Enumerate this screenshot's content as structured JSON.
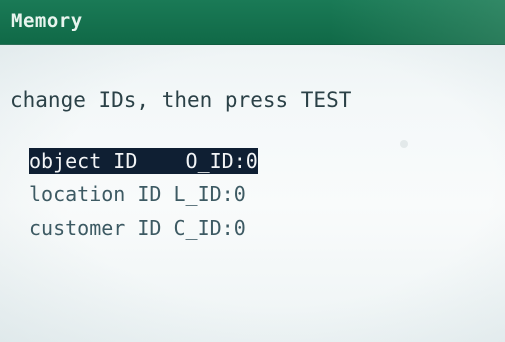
{
  "window": {
    "title": "Memory"
  },
  "instruction": "change IDs, then press TEST",
  "fields": [
    {
      "label": "object ID",
      "value": "O_ID:0",
      "selected": true
    },
    {
      "label": "location ID",
      "value": "L_ID:0",
      "selected": false
    },
    {
      "label": "customer ID",
      "value": "C_ID:0",
      "selected": false
    }
  ],
  "colors": {
    "title_bar": "#106947",
    "title_text": "#e8f4ee",
    "screen_bg": "#f3f7f8",
    "text": "#2b4147",
    "highlight_bg": "#0f1f33",
    "highlight_text": "#f2f4f6"
  }
}
